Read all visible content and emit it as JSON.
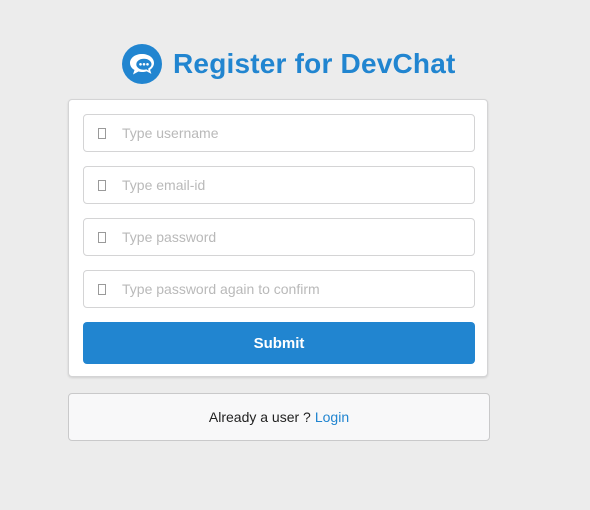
{
  "header": {
    "title": "Register for DevChat",
    "logo_icon": "chat-bubbles-icon"
  },
  "form": {
    "fields": [
      {
        "name": "username",
        "icon": "user-icon",
        "placeholder": "Type username",
        "value": ""
      },
      {
        "name": "email",
        "icon": "mail-icon",
        "placeholder": "Type email-id",
        "value": ""
      },
      {
        "name": "password",
        "icon": "lock-icon",
        "placeholder": "Type password",
        "value": ""
      },
      {
        "name": "confirm-password",
        "icon": "lock-icon",
        "placeholder": "Type password again to confirm",
        "value": ""
      }
    ],
    "submit_label": "Submit"
  },
  "message": {
    "text": "Already a user ?",
    "link_label": "Login"
  },
  "colors": {
    "accent": "#2185d0",
    "background": "#ececec",
    "card": "#ffffff"
  }
}
